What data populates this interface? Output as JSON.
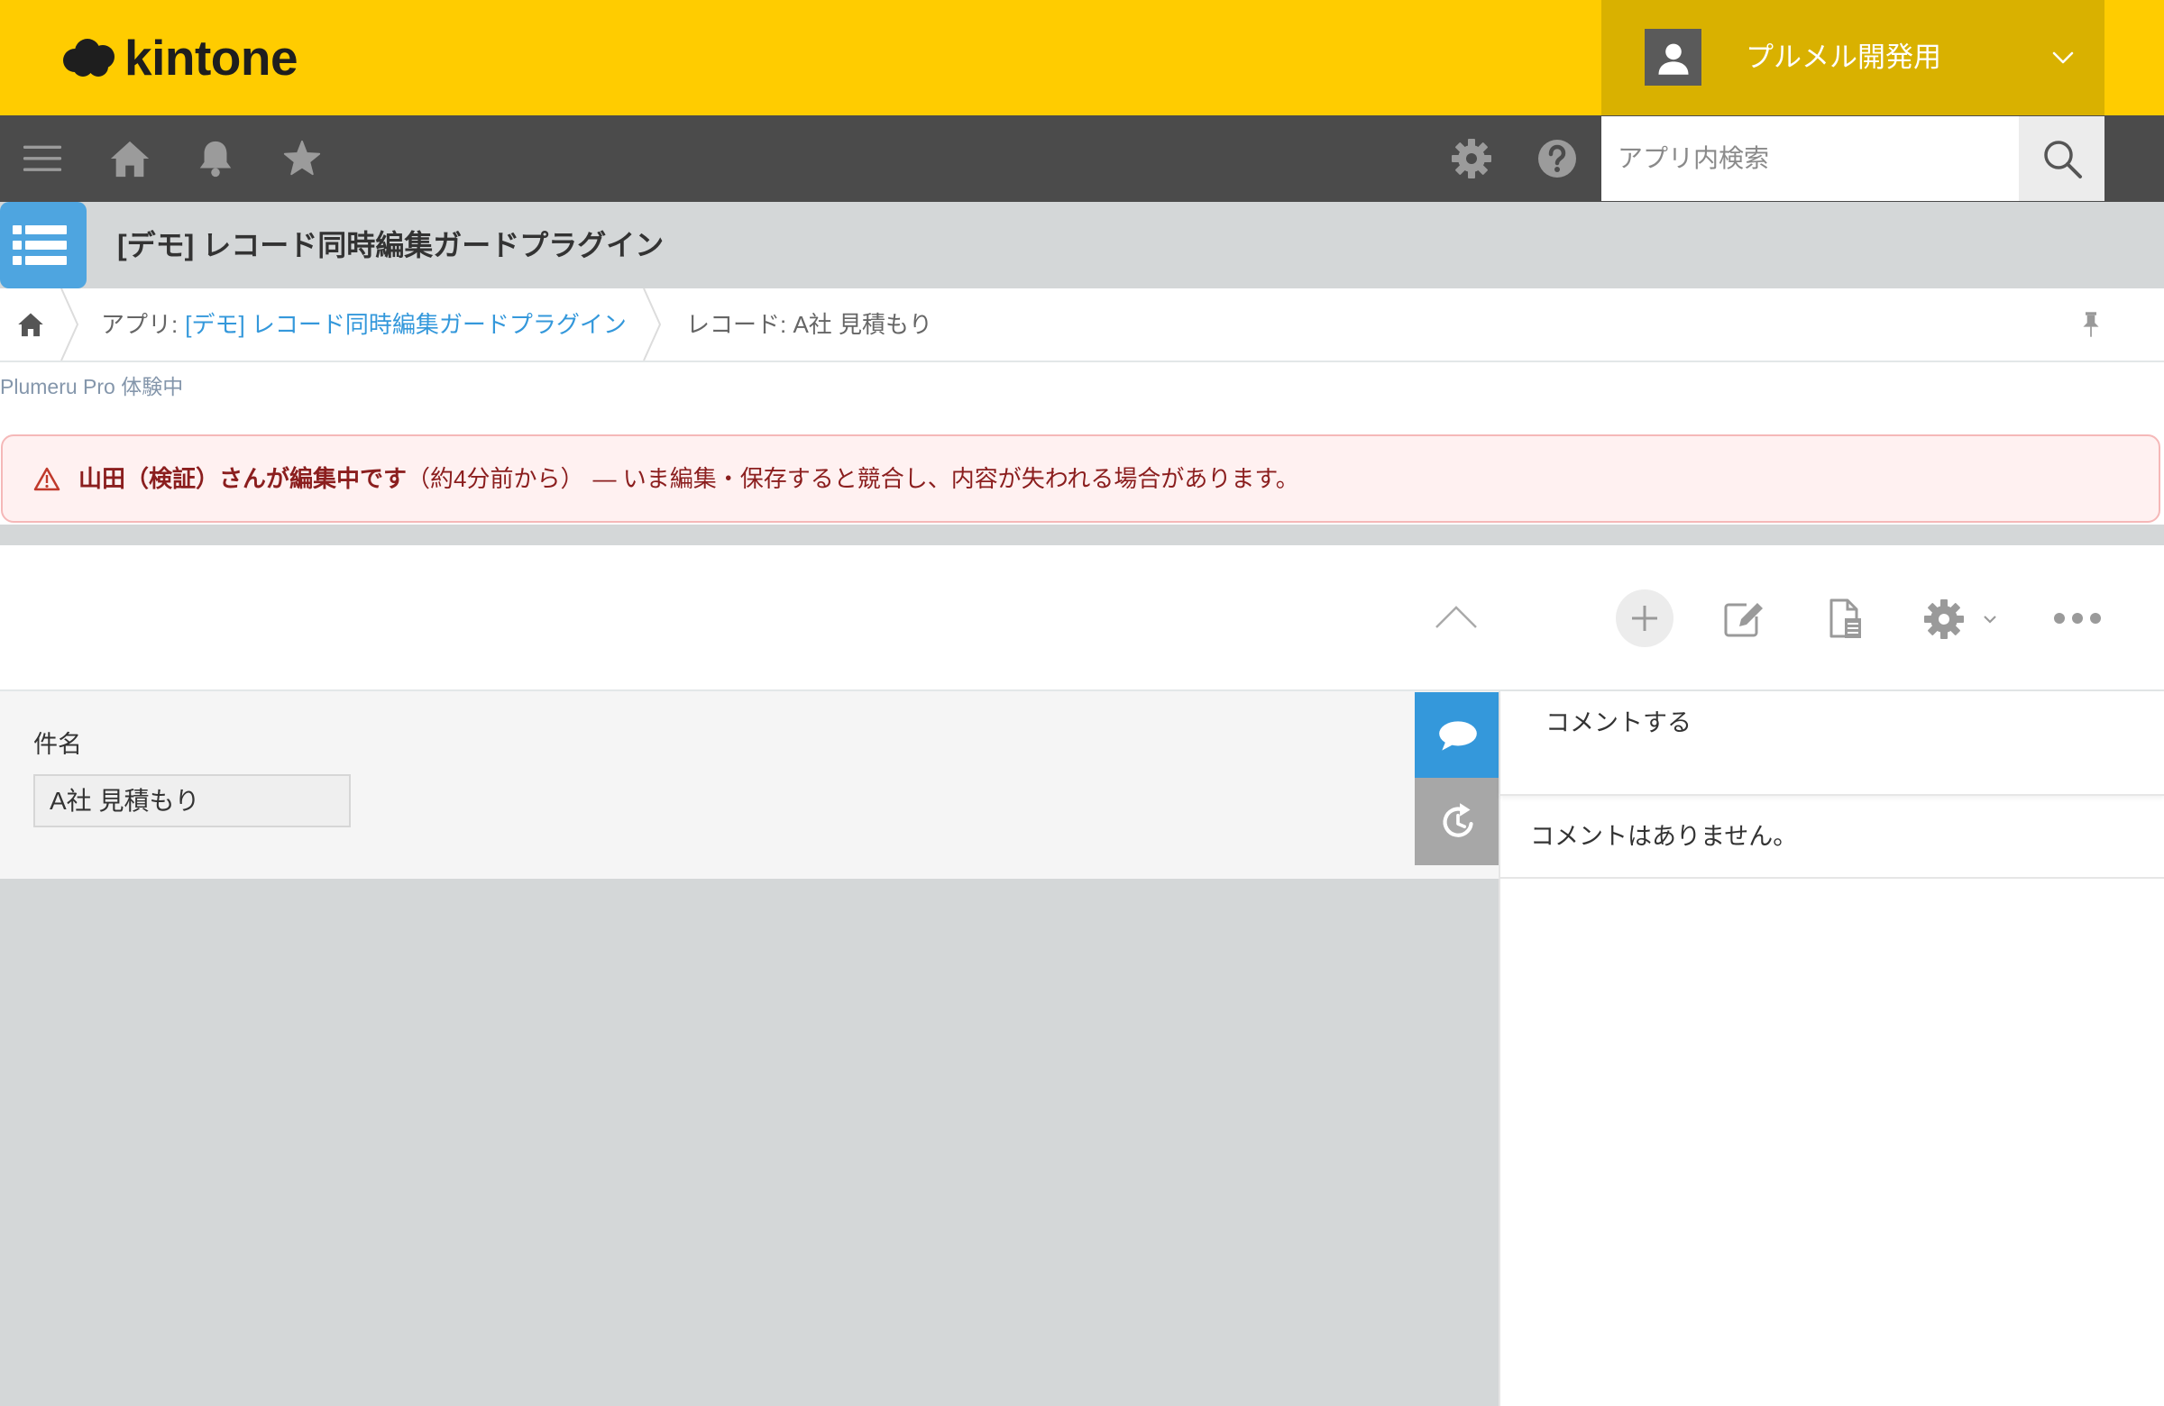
{
  "header": {
    "logo_text": "kintone",
    "logo_icon": "cloud-logo-icon",
    "user_name": "プルメル開発用",
    "user_icon": "user-avatar-icon",
    "user_menu_icon": "chevron-down-icon"
  },
  "nav": {
    "icons": [
      "menu-icon",
      "home-icon",
      "bell-icon",
      "star-icon",
      "gear-icon",
      "help-icon"
    ],
    "search_placeholder": "アプリ内検索",
    "search_icon": "search-icon"
  },
  "app": {
    "title": "[デモ] レコード同時編集ガードプラグイン",
    "icon": "app-list-icon"
  },
  "breadcrumb": {
    "home_icon": "home-icon",
    "app_prefix": "アプリ:",
    "app_name": "[デモ] レコード同時編集ガードプラグイン",
    "record": "レコード: A社 見積もり",
    "pin_icon": "pin-icon"
  },
  "trial_notice": "Plumeru Pro 体験中",
  "alert": {
    "icon": "warning-icon",
    "editor": "山田（検証）さんが編集中です",
    "since": "（約4分前から）",
    "message": "— いま編集・保存すると競合し、内容が失われる場合があります。"
  },
  "toolbar": {
    "icons": [
      "collapse-up-icon",
      "add-record-icon",
      "edit-icon",
      "copy-record-icon",
      "settings-gear-icon",
      "more-icon"
    ]
  },
  "record": {
    "fields": [
      {
        "label": "件名",
        "value": "A社 見積もり"
      }
    ]
  },
  "sidebar": {
    "tabs": [
      "comments-tab-icon",
      "history-tab-icon"
    ],
    "active_tab": "comments"
  },
  "comments": {
    "placeholder": "コメントする",
    "empty_text": "コメントはありません。"
  },
  "colors": {
    "brand_yellow": "#ffcc00",
    "user_menu": "#d9b100",
    "nav_dark": "#4b4b4b",
    "link_blue": "#3498db",
    "alert_text": "#8b1e1e",
    "alert_bg": "#fff1f1",
    "alert_border": "#f5b8b8",
    "history_tab": "#a7a7a7"
  }
}
